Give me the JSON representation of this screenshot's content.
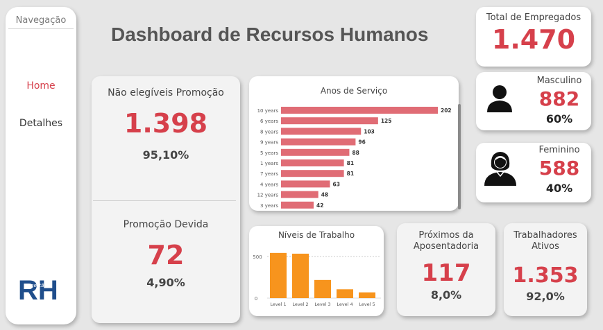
{
  "nav": {
    "title": "Navegação",
    "items": [
      {
        "label": "Home",
        "active": true
      },
      {
        "label": "Detalhes",
        "active": false
      }
    ],
    "logo_text": "RH",
    "logo_subtext": "gestão"
  },
  "header": {
    "title": "Dashboard de Recursos Humanos"
  },
  "kpis": {
    "total": {
      "label": "Total de Empregados",
      "value": "1.470"
    },
    "masculino": {
      "label": "Masculino",
      "value": "882",
      "pct": "60%"
    },
    "feminino": {
      "label": "Feminino",
      "value": "588",
      "pct": "40%"
    },
    "nao_elegiveis": {
      "label": "Não elegíveis Promoção",
      "value": "1.398",
      "pct": "95,10%"
    },
    "promocao_devida": {
      "label": "Promoção Devida",
      "value": "72",
      "pct": "4,90%"
    },
    "aposentadoria": {
      "label_line1": "Próximos da",
      "label_line2": "Aposentadoria",
      "value": "117",
      "pct": "8,0%"
    },
    "ativos": {
      "label_line1": "Trabalhadores",
      "label_line2": "Ativos",
      "value": "1.353",
      "pct": "92,0%"
    }
  },
  "colors": {
    "accent": "#d6404b",
    "bar_service": "#e06c75",
    "bar_level": "#f7941d"
  },
  "chart_data": [
    {
      "type": "bar",
      "orientation": "horizontal",
      "title": "Anos de Serviço",
      "categories": [
        "10 years",
        "6 years",
        "8 years",
        "9 years",
        "5 years",
        "1 years",
        "7 years",
        "4 years",
        "12 years",
        "3 years"
      ],
      "values": [
        202,
        125,
        103,
        96,
        88,
        81,
        81,
        63,
        48,
        42
      ],
      "data_labels": true
    },
    {
      "type": "bar",
      "orientation": "vertical",
      "title": "Níveis de Trabalho",
      "categories": [
        "Level 1",
        "Level 2",
        "Level 3",
        "Level 4",
        "Level 5"
      ],
      "values": [
        543,
        534,
        218,
        106,
        69
      ],
      "y_ticks": [
        "0",
        "500"
      ],
      "ylim": [
        0,
        600
      ],
      "grid": true
    }
  ]
}
